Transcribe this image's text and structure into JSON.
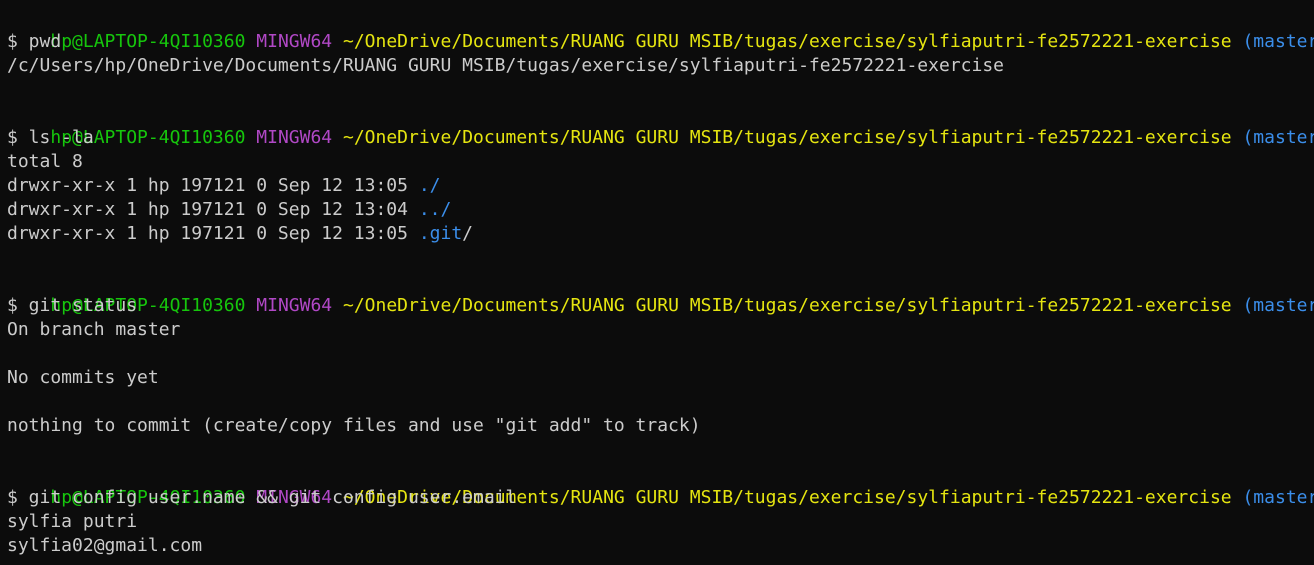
{
  "window": {
    "colors": {
      "background": "#0c0c0c",
      "text": "#cccccc",
      "user": "#16c60c",
      "system": "#b148c6",
      "path": "#e5e510",
      "branch": "#3b8eea",
      "directory": "#3b8eea"
    }
  },
  "prompt": {
    "user_host": "hp@LAPTOP-4QI10360",
    "system": "MINGW64",
    "path": "~/OneDrive/Documents/RUANG GURU MSIB/tugas/exercise/sylfiaputri-fe2572221-exercise",
    "branch": "(master)"
  },
  "blocks": [
    {
      "command": "$ pwd",
      "output": [
        "/c/Users/hp/OneDrive/Documents/RUANG GURU MSIB/tugas/exercise/sylfiaputri-fe2572221-exercise"
      ]
    },
    {
      "command": "$ ls -la",
      "output": [
        "total 8"
      ],
      "listing": [
        {
          "meta": "drwxr-xr-x 1 hp 197121 0 Sep 12 13:05 ",
          "name": "./",
          "suffix": ""
        },
        {
          "meta": "drwxr-xr-x 1 hp 197121 0 Sep 12 13:04 ",
          "name": "../",
          "suffix": ""
        },
        {
          "meta": "drwxr-xr-x 1 hp 197121 0 Sep 12 13:05 ",
          "name": ".git",
          "suffix": "/"
        }
      ]
    },
    {
      "command": "$ git status",
      "output": [
        "On branch master",
        "",
        "No commits yet",
        "",
        "nothing to commit (create/copy files and use \"git add\" to track)"
      ]
    },
    {
      "command": "$ git config user.name && git config user.email",
      "output": [
        "sylfia putri",
        "sylfia02@gmail.com"
      ]
    }
  ]
}
